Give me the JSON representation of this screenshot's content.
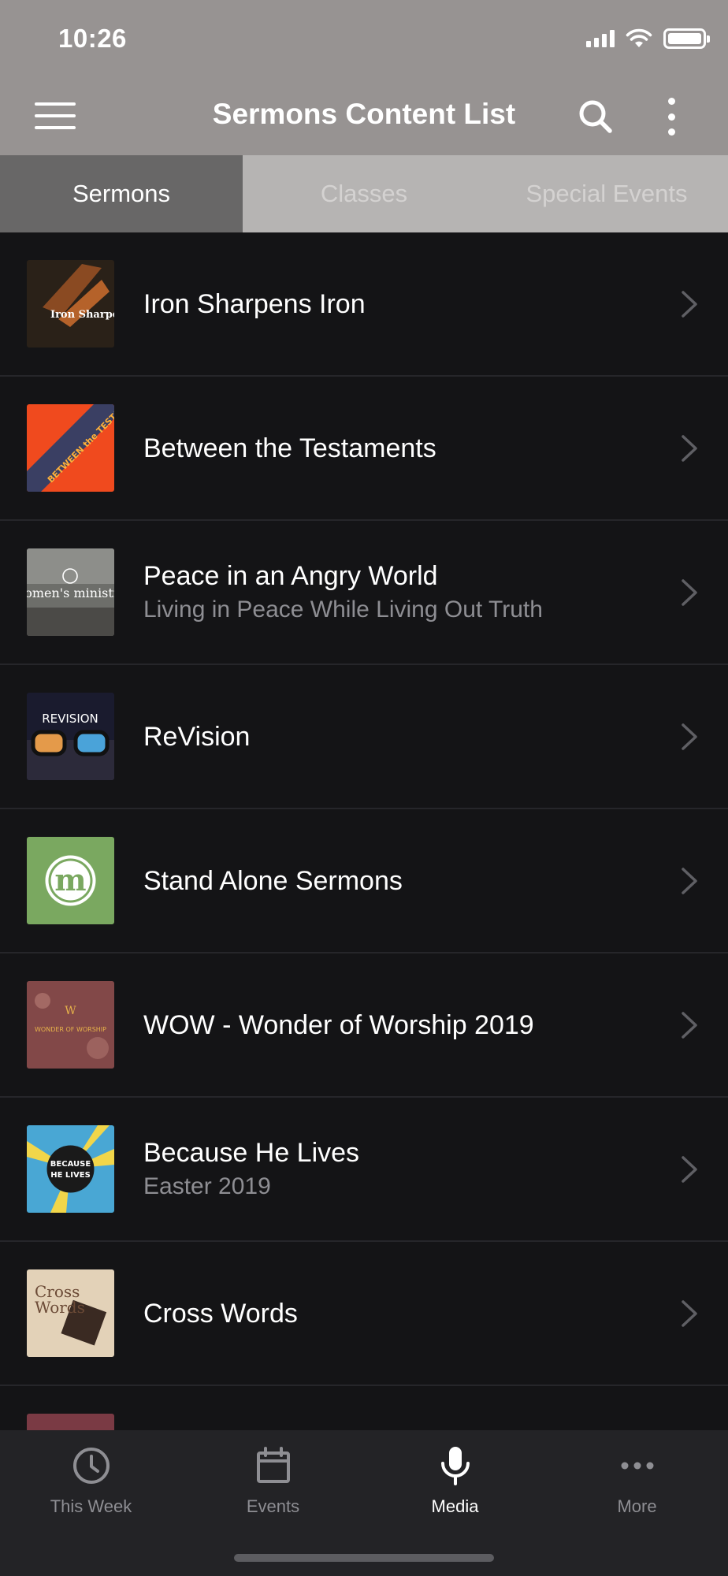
{
  "status_bar": {
    "time": "10:26"
  },
  "header": {
    "title": "Sermons Content List"
  },
  "tabs": [
    {
      "label": "Sermons",
      "active": true
    },
    {
      "label": "Classes",
      "active": false
    },
    {
      "label": "Special Events",
      "active": false
    }
  ],
  "list": [
    {
      "title": "Iron Sharpens Iron",
      "subtitle": "",
      "thumb_text": "Iron Sharpens Iron"
    },
    {
      "title": "Between the Testaments",
      "subtitle": "",
      "thumb_text": "BETWEEN the TESTAMENTS"
    },
    {
      "title": "Peace in an Angry World",
      "subtitle": "Living in Peace While Living Out Truth",
      "thumb_text": "women's ministry"
    },
    {
      "title": "ReVision",
      "subtitle": "",
      "thumb_text": "REVISION"
    },
    {
      "title": "Stand Alone Sermons",
      "subtitle": "",
      "thumb_text": "m"
    },
    {
      "title": "WOW - Wonder of Worship 2019",
      "subtitle": "",
      "thumb_text": "WONDER OF WORSHIP"
    },
    {
      "title": "Because He Lives",
      "subtitle": "Easter 2019",
      "thumb_text": "BECAUSE HE LIVES"
    },
    {
      "title": "Cross Words",
      "subtitle": "",
      "thumb_text": "Cross Words"
    }
  ],
  "bottom_nav": [
    {
      "label": "This Week",
      "icon": "clock-icon",
      "active": false
    },
    {
      "label": "Events",
      "icon": "calendar-icon",
      "active": false
    },
    {
      "label": "Media",
      "icon": "microphone-icon",
      "active": true
    },
    {
      "label": "More",
      "icon": "more-icon",
      "active": false
    }
  ],
  "colors": {
    "header_bg": "#979392",
    "tab_active_bg": "#686767",
    "tab_bg": "#b6b4b3",
    "list_bg": "#141416",
    "nav_bg": "#232326"
  }
}
